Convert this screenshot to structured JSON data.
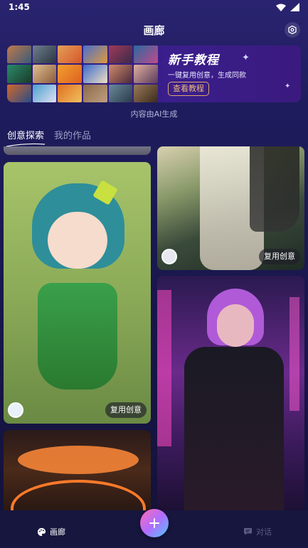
{
  "status": {
    "time": "1:45"
  },
  "header": {
    "title": "画廊"
  },
  "banner": {
    "title": "新手教程",
    "subtitle": "一键复用创意，生成同款",
    "button_label": "查看教程"
  },
  "ai_note": "内容由AI生成",
  "tabs": [
    {
      "label": "创意探索",
      "active": true
    },
    {
      "label": "我的作品",
      "active": false
    }
  ],
  "cards": [
    {
      "reuse_label": "复用创意"
    },
    {
      "reuse_label": "复用创意"
    }
  ],
  "nav": {
    "gallery_label": "画廊",
    "chat_label": "对话"
  },
  "colors": {
    "background": "#1c1a55",
    "accent_orange": "#f0b978",
    "tab_inactive": "#9e9cc4"
  }
}
